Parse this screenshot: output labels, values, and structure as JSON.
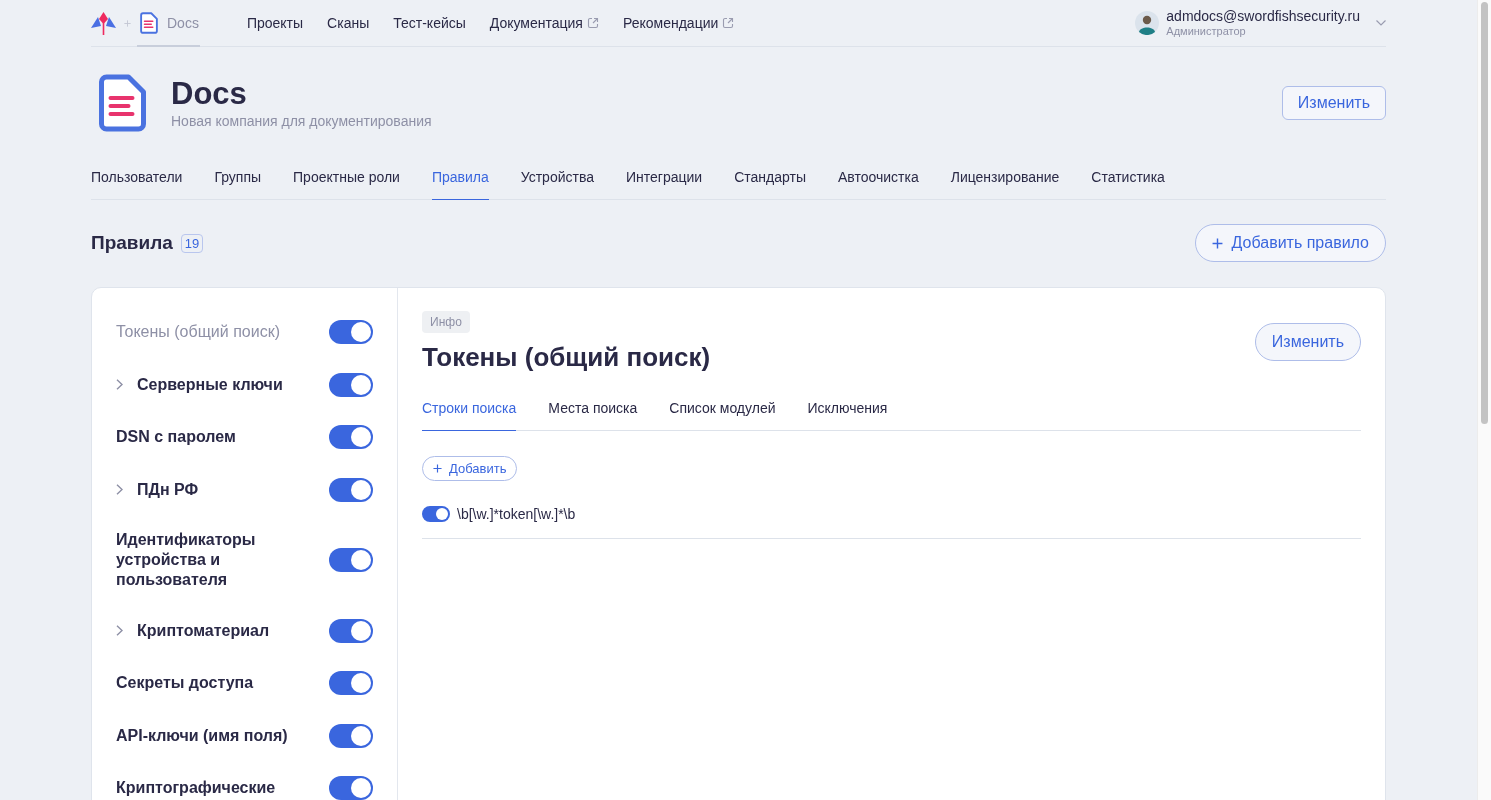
{
  "top_nav": {
    "product": "Docs",
    "links": [
      {
        "label": "Проекты",
        "external": false
      },
      {
        "label": "Сканы",
        "external": false
      },
      {
        "label": "Тест-кейсы",
        "external": false
      },
      {
        "label": "Документация",
        "external": true
      },
      {
        "label": "Рекомендации",
        "external": true
      }
    ]
  },
  "user": {
    "email": "admdocs@swordfishsecurity.ru",
    "role": "Администратор"
  },
  "company": {
    "name": "Docs",
    "description": "Новая компания для документирования",
    "edit_button": "Изменить"
  },
  "tabs": [
    {
      "label": "Пользователи",
      "selected": false
    },
    {
      "label": "Группы",
      "selected": false
    },
    {
      "label": "Проектные роли",
      "selected": false
    },
    {
      "label": "Правила",
      "selected": true
    },
    {
      "label": "Устройства",
      "selected": false
    },
    {
      "label": "Интеграции",
      "selected": false
    },
    {
      "label": "Стандарты",
      "selected": false
    },
    {
      "label": "Автоочистка",
      "selected": false
    },
    {
      "label": "Лицензирование",
      "selected": false
    },
    {
      "label": "Статистика",
      "selected": false
    }
  ],
  "section": {
    "title": "Правила",
    "count": "19",
    "add_button": "Добавить правило"
  },
  "rules": [
    {
      "name": "Токены (общий поиск)",
      "selected": true,
      "expandable": false,
      "enabled": true
    },
    {
      "name": "Серверные ключи",
      "selected": false,
      "expandable": true,
      "enabled": true
    },
    {
      "name": "DSN с паролем",
      "selected": false,
      "expandable": false,
      "enabled": true
    },
    {
      "name": "ПДн РФ",
      "selected": false,
      "expandable": true,
      "enabled": true
    },
    {
      "name": "Идентификаторы устройства и пользователя",
      "selected": false,
      "expandable": false,
      "enabled": true
    },
    {
      "name": "Криптоматериал",
      "selected": false,
      "expandable": true,
      "enabled": true
    },
    {
      "name": "Секреты доступа",
      "selected": false,
      "expandable": false,
      "enabled": true
    },
    {
      "name": "API-ключи (имя поля)",
      "selected": false,
      "expandable": false,
      "enabled": true
    },
    {
      "name": "Криптографические",
      "selected": false,
      "expandable": false,
      "enabled": true
    }
  ],
  "detail": {
    "tag": "Инфо",
    "title": "Токены (общий поиск)",
    "edit_button": "Изменить",
    "tabs": [
      {
        "label": "Строки поиска",
        "selected": true
      },
      {
        "label": "Места поиска",
        "selected": false
      },
      {
        "label": "Список модулей",
        "selected": false
      },
      {
        "label": "Исключения",
        "selected": false
      }
    ],
    "add_button": "Добавить",
    "patterns": [
      {
        "pattern": "\\b[\\w.]*token[\\w.]*\\b",
        "enabled": true
      }
    ]
  }
}
